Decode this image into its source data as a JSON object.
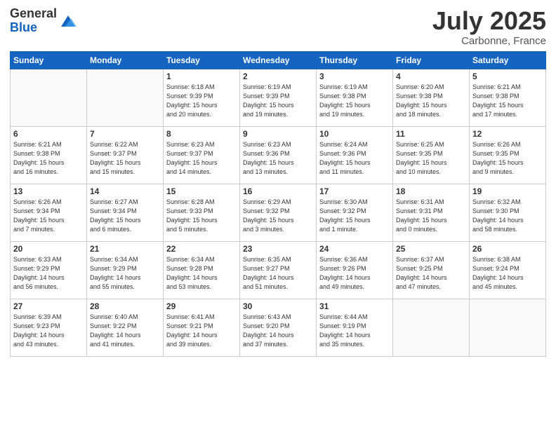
{
  "logo": {
    "general": "General",
    "blue": "Blue"
  },
  "title": {
    "month_year": "July 2025",
    "location": "Carbonne, France"
  },
  "headers": [
    "Sunday",
    "Monday",
    "Tuesday",
    "Wednesday",
    "Thursday",
    "Friday",
    "Saturday"
  ],
  "weeks": [
    [
      {
        "day": "",
        "info": ""
      },
      {
        "day": "",
        "info": ""
      },
      {
        "day": "1",
        "info": "Sunrise: 6:18 AM\nSunset: 9:39 PM\nDaylight: 15 hours\nand 20 minutes."
      },
      {
        "day": "2",
        "info": "Sunrise: 6:19 AM\nSunset: 9:39 PM\nDaylight: 15 hours\nand 19 minutes."
      },
      {
        "day": "3",
        "info": "Sunrise: 6:19 AM\nSunset: 9:38 PM\nDaylight: 15 hours\nand 19 minutes."
      },
      {
        "day": "4",
        "info": "Sunrise: 6:20 AM\nSunset: 9:38 PM\nDaylight: 15 hours\nand 18 minutes."
      },
      {
        "day": "5",
        "info": "Sunrise: 6:21 AM\nSunset: 9:38 PM\nDaylight: 15 hours\nand 17 minutes."
      }
    ],
    [
      {
        "day": "6",
        "info": "Sunrise: 6:21 AM\nSunset: 9:38 PM\nDaylight: 15 hours\nand 16 minutes."
      },
      {
        "day": "7",
        "info": "Sunrise: 6:22 AM\nSunset: 9:37 PM\nDaylight: 15 hours\nand 15 minutes."
      },
      {
        "day": "8",
        "info": "Sunrise: 6:23 AM\nSunset: 9:37 PM\nDaylight: 15 hours\nand 14 minutes."
      },
      {
        "day": "9",
        "info": "Sunrise: 6:23 AM\nSunset: 9:36 PM\nDaylight: 15 hours\nand 13 minutes."
      },
      {
        "day": "10",
        "info": "Sunrise: 6:24 AM\nSunset: 9:36 PM\nDaylight: 15 hours\nand 11 minutes."
      },
      {
        "day": "11",
        "info": "Sunrise: 6:25 AM\nSunset: 9:35 PM\nDaylight: 15 hours\nand 10 minutes."
      },
      {
        "day": "12",
        "info": "Sunrise: 6:26 AM\nSunset: 9:35 PM\nDaylight: 15 hours\nand 9 minutes."
      }
    ],
    [
      {
        "day": "13",
        "info": "Sunrise: 6:26 AM\nSunset: 9:34 PM\nDaylight: 15 hours\nand 7 minutes."
      },
      {
        "day": "14",
        "info": "Sunrise: 6:27 AM\nSunset: 9:34 PM\nDaylight: 15 hours\nand 6 minutes."
      },
      {
        "day": "15",
        "info": "Sunrise: 6:28 AM\nSunset: 9:33 PM\nDaylight: 15 hours\nand 5 minutes."
      },
      {
        "day": "16",
        "info": "Sunrise: 6:29 AM\nSunset: 9:32 PM\nDaylight: 15 hours\nand 3 minutes."
      },
      {
        "day": "17",
        "info": "Sunrise: 6:30 AM\nSunset: 9:32 PM\nDaylight: 15 hours\nand 1 minute."
      },
      {
        "day": "18",
        "info": "Sunrise: 6:31 AM\nSunset: 9:31 PM\nDaylight: 15 hours\nand 0 minutes."
      },
      {
        "day": "19",
        "info": "Sunrise: 6:32 AM\nSunset: 9:30 PM\nDaylight: 14 hours\nand 58 minutes."
      }
    ],
    [
      {
        "day": "20",
        "info": "Sunrise: 6:33 AM\nSunset: 9:29 PM\nDaylight: 14 hours\nand 56 minutes."
      },
      {
        "day": "21",
        "info": "Sunrise: 6:34 AM\nSunset: 9:29 PM\nDaylight: 14 hours\nand 55 minutes."
      },
      {
        "day": "22",
        "info": "Sunrise: 6:34 AM\nSunset: 9:28 PM\nDaylight: 14 hours\nand 53 minutes."
      },
      {
        "day": "23",
        "info": "Sunrise: 6:35 AM\nSunset: 9:27 PM\nDaylight: 14 hours\nand 51 minutes."
      },
      {
        "day": "24",
        "info": "Sunrise: 6:36 AM\nSunset: 9:26 PM\nDaylight: 14 hours\nand 49 minutes."
      },
      {
        "day": "25",
        "info": "Sunrise: 6:37 AM\nSunset: 9:25 PM\nDaylight: 14 hours\nand 47 minutes."
      },
      {
        "day": "26",
        "info": "Sunrise: 6:38 AM\nSunset: 9:24 PM\nDaylight: 14 hours\nand 45 minutes."
      }
    ],
    [
      {
        "day": "27",
        "info": "Sunrise: 6:39 AM\nSunset: 9:23 PM\nDaylight: 14 hours\nand 43 minutes."
      },
      {
        "day": "28",
        "info": "Sunrise: 6:40 AM\nSunset: 9:22 PM\nDaylight: 14 hours\nand 41 minutes."
      },
      {
        "day": "29",
        "info": "Sunrise: 6:41 AM\nSunset: 9:21 PM\nDaylight: 14 hours\nand 39 minutes."
      },
      {
        "day": "30",
        "info": "Sunrise: 6:43 AM\nSunset: 9:20 PM\nDaylight: 14 hours\nand 37 minutes."
      },
      {
        "day": "31",
        "info": "Sunrise: 6:44 AM\nSunset: 9:19 PM\nDaylight: 14 hours\nand 35 minutes."
      },
      {
        "day": "",
        "info": ""
      },
      {
        "day": "",
        "info": ""
      }
    ]
  ]
}
